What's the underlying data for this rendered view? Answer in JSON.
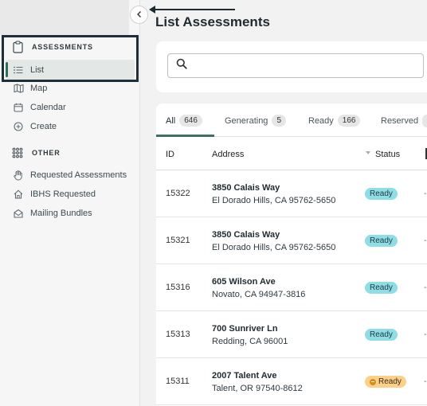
{
  "sidebar": {
    "sections": [
      {
        "title": "ASSESSMENTS",
        "icon": "clipboard-icon",
        "items": [
          {
            "label": "List",
            "icon": "list-icon",
            "active": true
          },
          {
            "label": "Map",
            "icon": "map-icon"
          },
          {
            "label": "Calendar",
            "icon": "calendar-icon"
          },
          {
            "label": "Create",
            "icon": "plus-circle-icon"
          }
        ]
      },
      {
        "title": "OTHER",
        "icon": "grid-dots-icon",
        "items": [
          {
            "label": "Requested Assessments",
            "icon": "hand-icon"
          },
          {
            "label": "IBHS Requested",
            "icon": "house-icon"
          },
          {
            "label": "Mailing Bundles",
            "icon": "envelope-open-icon"
          }
        ]
      }
    ]
  },
  "main": {
    "title": "List Assessments",
    "search": {
      "placeholder": "",
      "value": ""
    },
    "tabs": [
      {
        "label": "All",
        "count": "646",
        "active": true
      },
      {
        "label": "Generating",
        "count": "5"
      },
      {
        "label": "Ready",
        "count": "166"
      },
      {
        "label": "Reserved",
        "count": ""
      }
    ],
    "columns": {
      "id": "ID",
      "address": "Address",
      "status": "Status"
    },
    "rows": [
      {
        "id": "15322",
        "street": "3850 Calais Way",
        "city": "El Dorado Hills, CA 95762-5650",
        "status": "Ready",
        "status_type": "ready",
        "extra": "-"
      },
      {
        "id": "15321",
        "street": "3850 Calais Way",
        "city": "El Dorado Hills, CA 95762-5650",
        "status": "Ready",
        "status_type": "ready",
        "extra": "-"
      },
      {
        "id": "15316",
        "street": "605 Wilson Ave",
        "city": "Novato, CA 94947-3816",
        "status": "Ready",
        "status_type": "ready",
        "extra": "-"
      },
      {
        "id": "15313",
        "street": "700 Sunriver Ln",
        "city": "Redding, CA 96001",
        "status": "Ready",
        "status_type": "ready",
        "extra": "-"
      },
      {
        "id": "15311",
        "street": "2007 Talent Ave",
        "city": "Talent, OR 97540-8612",
        "status": "Ready",
        "status_type": "warning",
        "extra": "-"
      }
    ]
  },
  "colors": {
    "accent": "#3f6f5f",
    "ready_badge": "#8fdde5",
    "warning_badge": "#fbd08b",
    "annotation": "#1d2f38"
  }
}
